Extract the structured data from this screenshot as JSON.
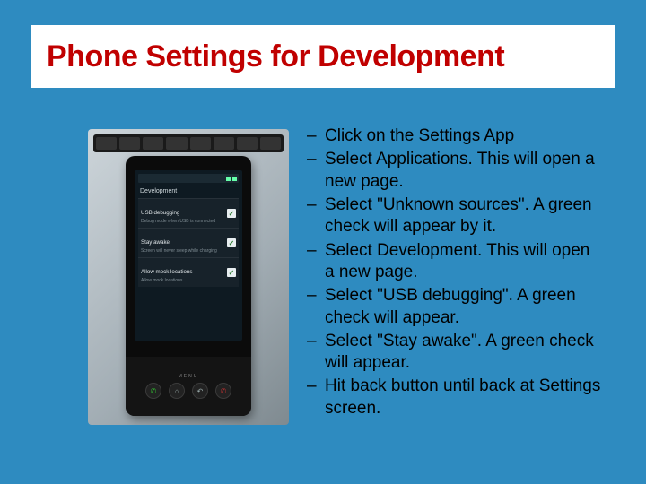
{
  "title": "Phone Settings for Development",
  "bullets": [
    "Click on the Settings App",
    "Select Applications.  This will open a new page.",
    "Select \"Unknown sources\".  A green check will appear by it.",
    "Select Development. This will open a new page.",
    "Select \"USB debugging\". A green check will appear.",
    "Select \"Stay awake\". A green check will appear.",
    "Hit back button until back at Settings screen."
  ],
  "phone": {
    "screen_title": "Development",
    "rows": [
      {
        "label": "USB debugging",
        "sub": "Debug mode when USB is connected"
      },
      {
        "label": "Stay awake",
        "sub": "Screen will never sleep while charging"
      },
      {
        "label": "Allow mock locations",
        "sub": "Allow mock locations"
      }
    ],
    "menu_label": "MENU"
  }
}
